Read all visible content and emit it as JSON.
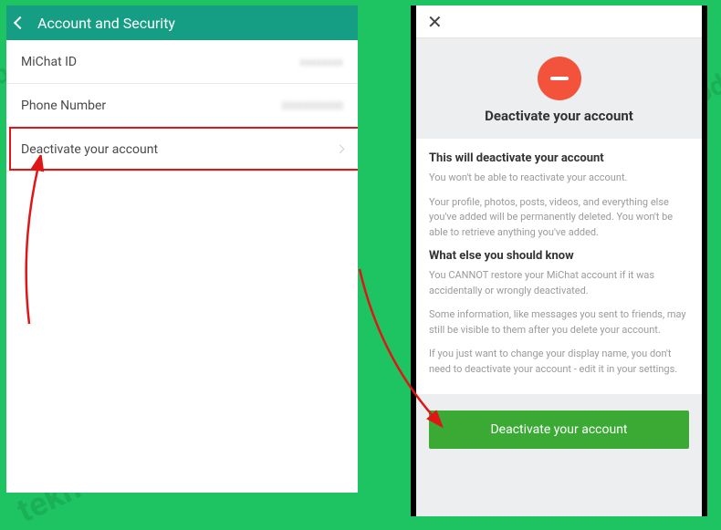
{
  "watermark": "teknoding.com",
  "leftPhone": {
    "headerTitle": "Account and Security",
    "rows": {
      "michatId": {
        "label": "MiChat ID",
        "value": "xxxxxxxx"
      },
      "phone": {
        "label": "Phone Number",
        "value": "0000000000"
      },
      "deactivate": {
        "label": "Deactivate your account"
      }
    }
  },
  "rightPhone": {
    "title": "Deactivate your account",
    "section1Title": "This will deactivate your account",
    "p1": "You won't be able to reactivate your account.",
    "p2": "Your profile, photos, posts, videos, and everything else you've added will be permanently deleted. You won't be able to retrieve anything you've added.",
    "section2Title": "What else you should know",
    "p3": "You CANNOT restore your MiChat account if it was accidentally or wrongly deactivated.",
    "p4": "Some information, like messages you sent to friends, may still be visible to them after you delete your account.",
    "p5": "If you just want to change your display name, you don't need to deactivate your account - edit it in your settings.",
    "buttonLabel": "Deactivate your account"
  }
}
